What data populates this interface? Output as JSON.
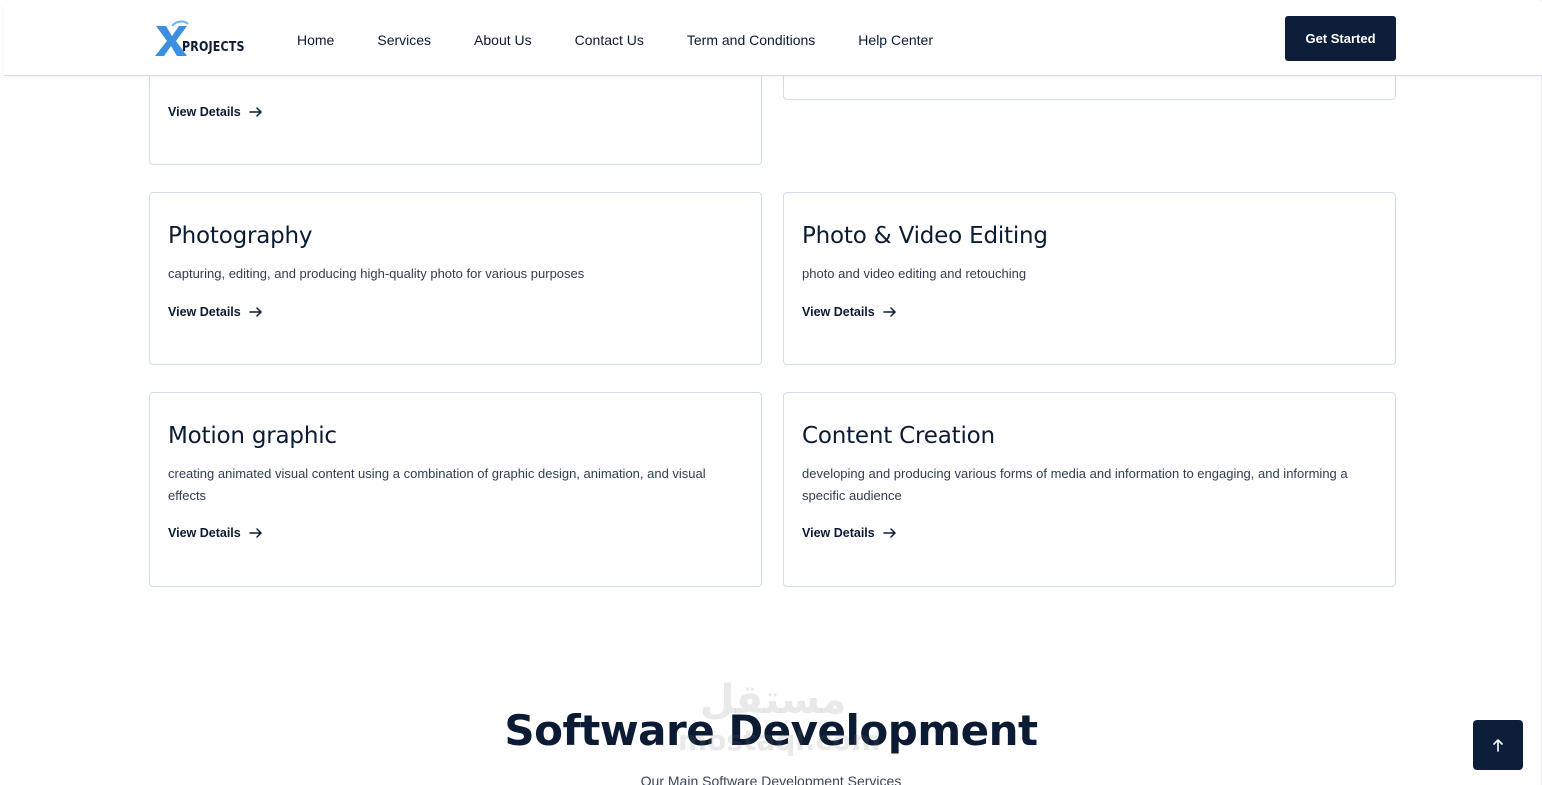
{
  "header": {
    "logo_letter": "X",
    "logo_text": "PROJECTS",
    "nav": [
      {
        "label": "Home"
      },
      {
        "label": "Services"
      },
      {
        "label": "About Us"
      },
      {
        "label": "Contact Us"
      },
      {
        "label": "Term and Conditions"
      },
      {
        "label": "Help Center"
      }
    ],
    "cta_label": "Get Started"
  },
  "cards_top": {
    "left_link": "View Details"
  },
  "cards": [
    {
      "title": "Photography",
      "description": "capturing, editing, and producing high-quality photo for various purposes",
      "link": "View Details"
    },
    {
      "title": "Photo & Video Editing",
      "description": "photo and video editing and retouching",
      "link": "View Details"
    },
    {
      "title": "Motion graphic",
      "description": "creating animated visual content using a combination of graphic design, animation, and visual effects",
      "link": "View Details"
    },
    {
      "title": "Content Creation",
      "description": "developing and producing various forms of media and information to engaging, and informing a specific audience",
      "link": "View Details"
    }
  ],
  "section": {
    "title": "Software Development",
    "subtitle": "Our Main Software Development Services"
  },
  "watermark": {
    "arabic": "مستقل",
    "latin": "mostaql.com"
  },
  "colors": {
    "navy": "#0c1e3a",
    "card_border": "#cfe0e4",
    "logo_blue": "#3b8fe0"
  },
  "icons": {
    "arrow": "arrow-right-icon",
    "to_top": "arrow-up-icon"
  }
}
